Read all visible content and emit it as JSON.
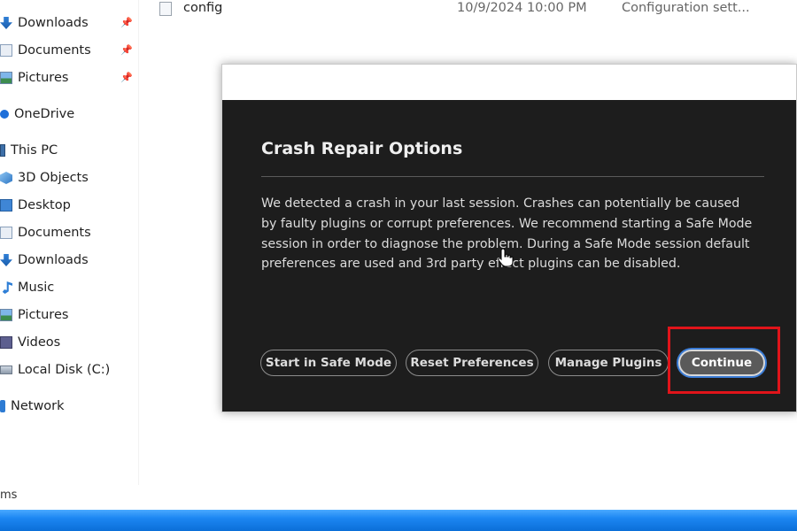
{
  "nav_pane": {
    "quick_access": [
      {
        "label": "Downloads",
        "icon": "download-icon",
        "pinned": true
      },
      {
        "label": "Documents",
        "icon": "document-icon",
        "pinned": true
      },
      {
        "label": "Pictures",
        "icon": "pictures-icon",
        "pinned": true
      }
    ],
    "onedrive": {
      "label": "OneDrive",
      "icon": "onedrive-icon"
    },
    "this_pc": {
      "label": "This PC",
      "icon": "computer-icon"
    },
    "pc_items": [
      {
        "label": "3D Objects",
        "icon": "3d-objects-icon"
      },
      {
        "label": "Desktop",
        "icon": "desktop-icon"
      },
      {
        "label": "Documents",
        "icon": "document-icon"
      },
      {
        "label": "Downloads",
        "icon": "download-icon"
      },
      {
        "label": "Music",
        "icon": "music-icon"
      },
      {
        "label": "Pictures",
        "icon": "pictures-icon"
      },
      {
        "label": "Videos",
        "icon": "videos-icon"
      },
      {
        "label": "Local Disk (C:)",
        "icon": "local-disk-icon"
      }
    ],
    "network": {
      "label": "Network",
      "icon": "network-icon"
    }
  },
  "file_list": {
    "rows": [
      {
        "name": "config",
        "date": "10/9/2024 10:00 PM",
        "type": "Configuration sett..."
      }
    ]
  },
  "status_bar": {
    "text": "ms"
  },
  "dialog": {
    "title": "Crash Repair Options",
    "message": "We detected a crash in your last session. Crashes can potentially be caused by faulty plugins or corrupt preferences. We recommend starting a Safe Mode session in order to diagnose the problem. During a Safe Mode session default preferences are used and 3rd party effect plugins can be disabled.",
    "buttons": {
      "safe_mode": "Start in Safe Mode",
      "reset_preferences": "Reset Preferences",
      "manage_plugins": "Manage Plugins",
      "continue": "Continue"
    }
  },
  "colors": {
    "dialog_bg": "#1d1d1d",
    "highlight": "#e0141a",
    "taskbar": "#0b6fd8",
    "focus_ring": "#3a7bd5"
  }
}
